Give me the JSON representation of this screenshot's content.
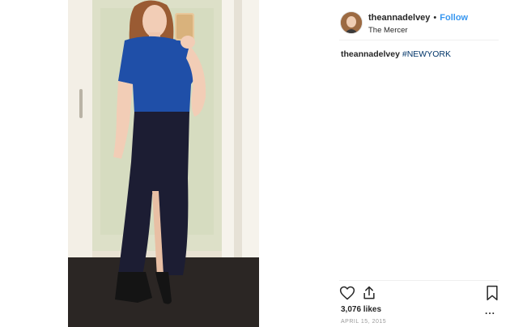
{
  "post": {
    "username": "theannadelvey",
    "separator": "•",
    "follow_label": "Follow",
    "location": "The Mercer",
    "caption_username": "theannadelvey",
    "caption_hashtag": "#NEWYORK",
    "likes": "3,076 likes",
    "date": "APRIL 15, 2015",
    "more": "..."
  },
  "icons": {
    "like": "heart-icon",
    "share": "share-icon",
    "save": "bookmark-icon"
  },
  "colors": {
    "follow": "#3897f0",
    "hashtag": "#003569",
    "muted": "#999999"
  }
}
